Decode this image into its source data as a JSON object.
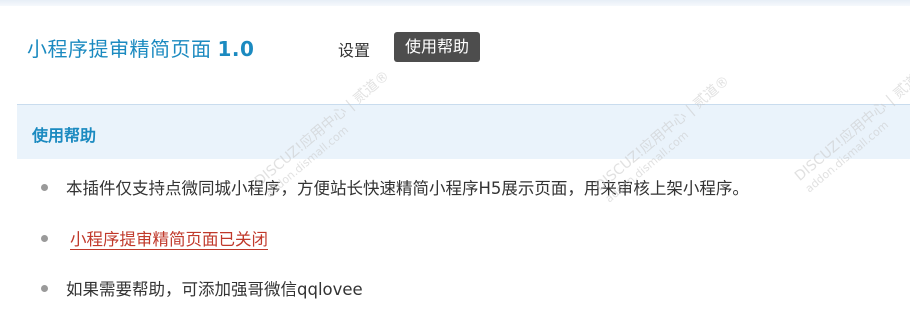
{
  "header": {
    "app_title": "小程序提审精简页面",
    "version": "1.0",
    "menu": {
      "settings_label": "设置",
      "help_label": "使用帮助"
    }
  },
  "help_section": {
    "title": "使用帮助",
    "items": [
      "本插件仅支持点微同城小程序，方便站长快速精简小程序H5展示页面，用来审核上架小程序。",
      "小程序提审精简页面已关闭",
      "如果需要帮助，可添加强哥微信qqlovee"
    ]
  },
  "watermark": {
    "brand": "DISCUZ!应用中心 | 贰道®",
    "site": "addon.dismall.com"
  },
  "colors": {
    "accent_blue": "#1b8ac0",
    "active_menu_bg": "#4d4d4d",
    "section_header_bg": "#eaf3fb",
    "link_red": "#c0392b",
    "text": "#333333"
  }
}
